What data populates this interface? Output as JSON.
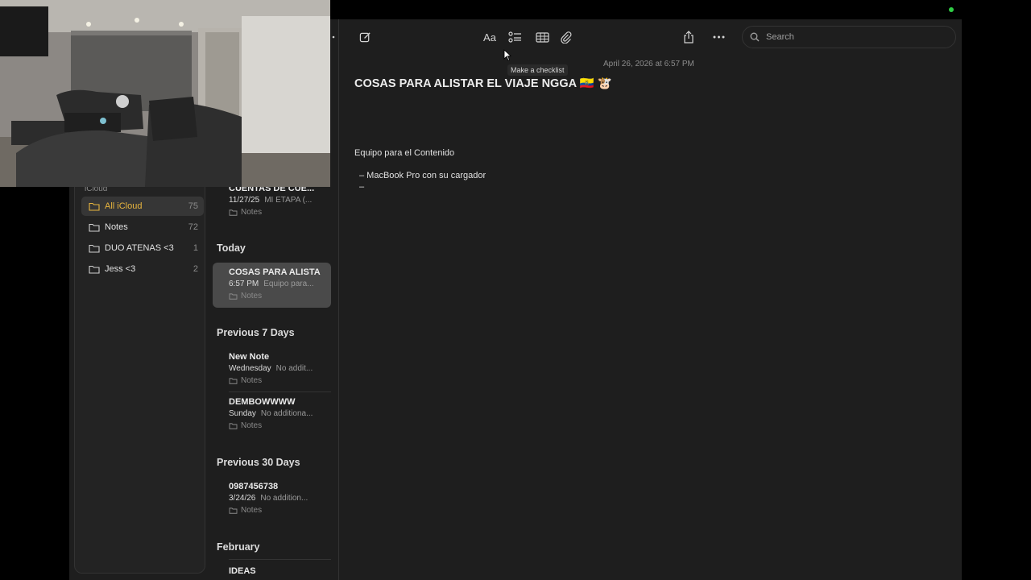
{
  "sidebar": {
    "section": "iCloud",
    "folders": [
      {
        "name": "All iCloud",
        "count": "75",
        "selected": true
      },
      {
        "name": "Notes",
        "count": "72"
      },
      {
        "name": "DUO ATENAS <3",
        "count": "1"
      },
      {
        "name": "Jess <3",
        "count": "2"
      }
    ]
  },
  "notes_list": {
    "top_partial": {
      "title": "CUENTAS DE CUE...",
      "date": "11/27/25",
      "preview": "MI ETAPA (...",
      "folder": "Notes"
    },
    "groups": [
      {
        "header": "Today",
        "notes": [
          {
            "title": "COSAS PARA ALISTA",
            "date": "6:57 PM",
            "preview": "Equipo para...",
            "folder": "Notes",
            "selected": true
          }
        ]
      },
      {
        "header": "Previous 7 Days",
        "notes": [
          {
            "title": "New Note",
            "date": "Wednesday",
            "preview": "No addit...",
            "folder": "Notes"
          },
          {
            "title": "DEMBOWWWW",
            "date": "Sunday",
            "preview": "No additiona...",
            "folder": "Notes"
          }
        ]
      },
      {
        "header": "Previous 30 Days",
        "notes": [
          {
            "title": "0987456738",
            "date": "3/24/26",
            "preview": "No addition...",
            "folder": "Notes"
          }
        ]
      },
      {
        "header": "February",
        "notes": [
          {
            "title": "IDEAS",
            "date": "",
            "preview": "",
            "folder": ""
          }
        ]
      }
    ]
  },
  "toolbar": {
    "format_label": "Aa",
    "tooltip": "Make a checklist",
    "search_placeholder": "Search"
  },
  "editor": {
    "timestamp": "April 26, 2026 at 6:57 PM",
    "title": "COSAS PARA ALISTAR EL VIAJE NGGA",
    "title_emoji": "🇪🇨 🐮",
    "section": "Equipo para el Contenido",
    "items": [
      "–  MacBook Pro con su cargador",
      "–"
    ]
  },
  "colors": {
    "accent": "#e8b53e",
    "background": "#1e1e1e",
    "status": "#2fce45"
  }
}
